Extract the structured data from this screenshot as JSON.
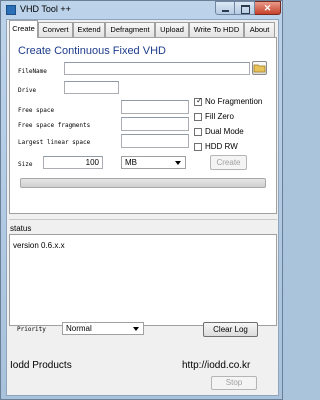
{
  "window": {
    "title": "VHD Tool ++"
  },
  "tabs": [
    "Create",
    "Convert",
    "Extend",
    "Defragment",
    "Upload",
    "Write To HDD",
    "About"
  ],
  "create": {
    "heading": "Create Continuous Fixed VHD",
    "filename_label": "FileName",
    "drive_label": "Drive",
    "free_space_label": "Free space",
    "free_space_fragments_label": "Free space fragments",
    "largest_linear_space_label": "Largest linear space",
    "size_label": "Size",
    "size_value": "100",
    "unit_selected": "MB",
    "options": [
      {
        "label": "No Fragmention",
        "checked": true
      },
      {
        "label": "Fill Zero",
        "checked": false
      },
      {
        "label": "Dual Mode",
        "checked": false
      },
      {
        "label": "HDD RW",
        "checked": false
      }
    ],
    "create_button": "Create"
  },
  "status": {
    "label": "status",
    "log_text": "version 0.6.x.x"
  },
  "footer": {
    "priority_label": "Priority",
    "priority_selected": "Normal",
    "clear_log_button": "Clear Log",
    "brand": "Iodd Products",
    "url": "http://iodd.co.kr",
    "stop_button": "Stop"
  }
}
